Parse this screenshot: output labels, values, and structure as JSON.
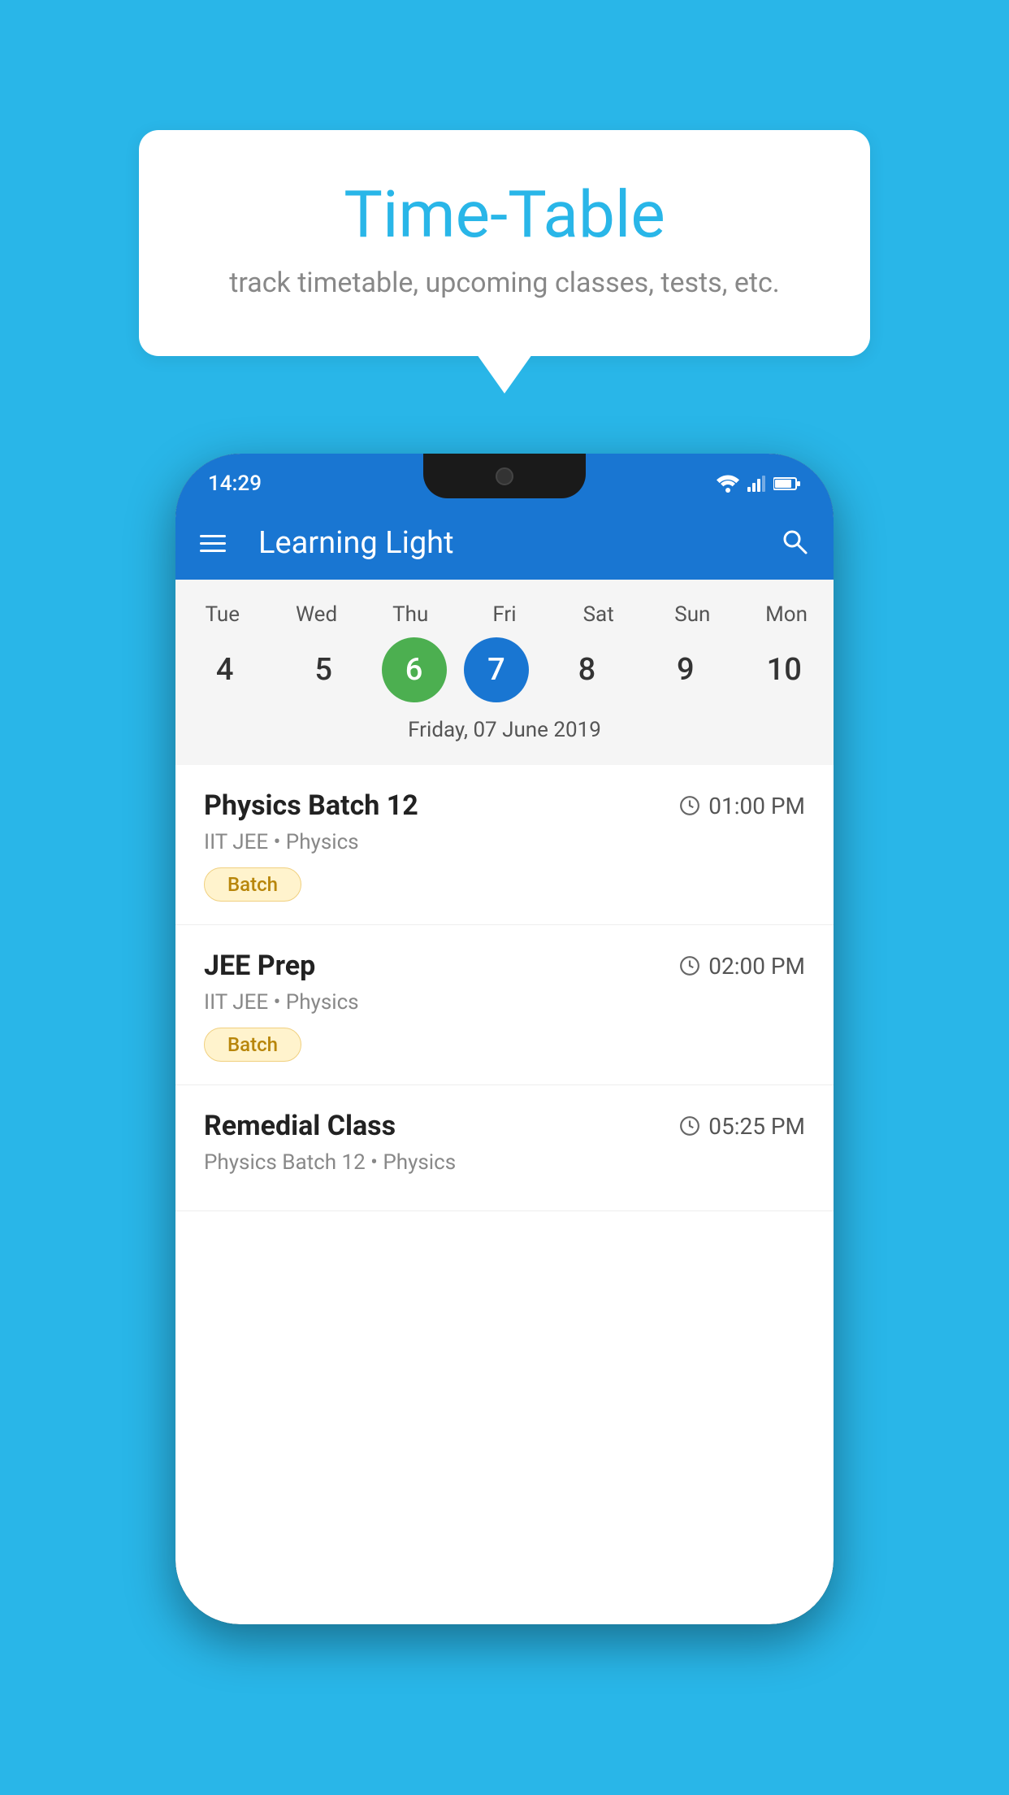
{
  "background_color": "#29B6E8",
  "tooltip": {
    "title": "Time-Table",
    "subtitle": "track timetable, upcoming classes, tests, etc."
  },
  "phone": {
    "status_bar": {
      "time": "14:29"
    },
    "app_bar": {
      "title": "Learning Light"
    },
    "calendar": {
      "days": [
        "Tue",
        "Wed",
        "Thu",
        "Fri",
        "Sat",
        "Sun",
        "Mon"
      ],
      "dates": [
        "4",
        "5",
        "6",
        "7",
        "8",
        "9",
        "10"
      ],
      "today_index": 2,
      "selected_index": 3,
      "selected_label": "Friday, 07 June 2019"
    },
    "schedule": [
      {
        "title": "Physics Batch 12",
        "time": "01:00 PM",
        "subtitle": "IIT JEE • Physics",
        "tag": "Batch"
      },
      {
        "title": "JEE Prep",
        "time": "02:00 PM",
        "subtitle": "IIT JEE • Physics",
        "tag": "Batch"
      },
      {
        "title": "Remedial Class",
        "time": "05:25 PM",
        "subtitle": "Physics Batch 12 • Physics",
        "tag": null
      }
    ]
  }
}
